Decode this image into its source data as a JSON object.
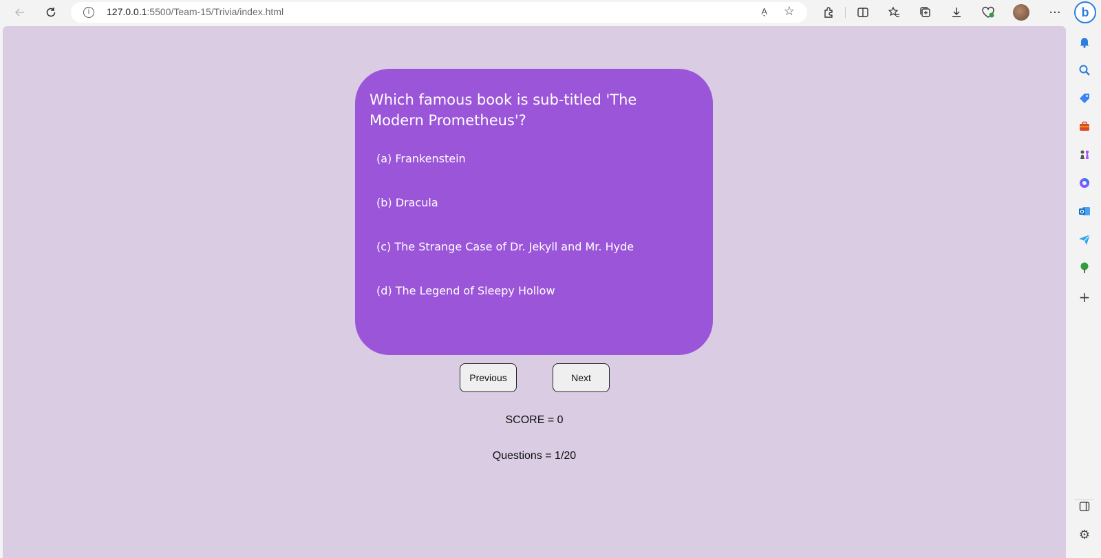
{
  "browser": {
    "url_host": "127.0.0.1",
    "url_rest": ":5500/Team-15/Trivia/index.html",
    "read_aloud_label": "A͉"
  },
  "trivia": {
    "question": "Which famous book is sub-titled 'The Modern Prometheus'?",
    "options": [
      "(a) Frankenstein",
      "(b) Dracula",
      "(c) The Strange Case of Dr. Jekyll and Mr. Hyde",
      "(d) The Legend of Sleepy Hollow"
    ],
    "previous_label": "Previous",
    "next_label": "Next",
    "score_text": "SCORE = 0",
    "progress_text": "Questions = 1/20"
  },
  "colors": {
    "page_bg": "#d9cce3",
    "card_bg": "#9b55d9",
    "accent": "#2a7de1"
  }
}
